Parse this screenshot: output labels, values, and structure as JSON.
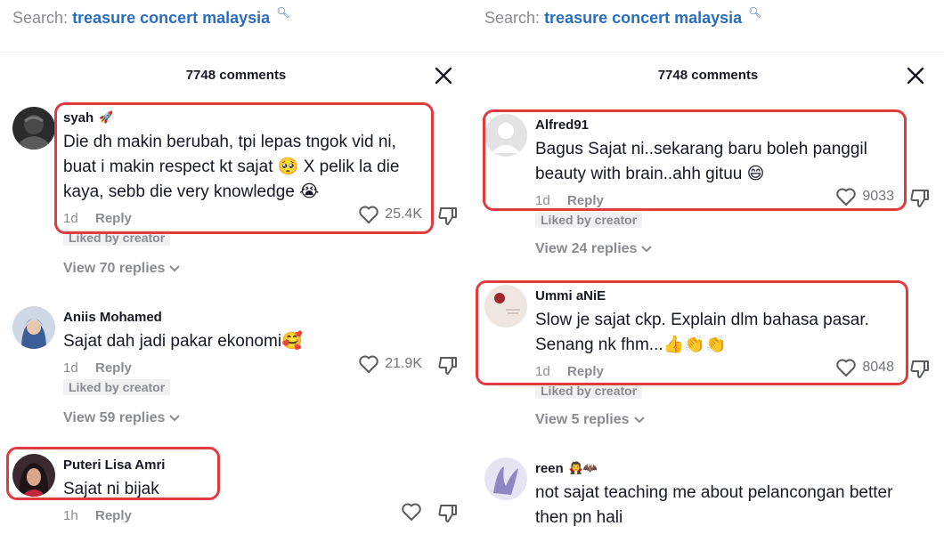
{
  "left": {
    "search_prefix": "Search:",
    "search_query": "treasure concert malaysia",
    "comment_count": "7748 comments",
    "comments": [
      {
        "username": "syah",
        "username_emoji": "🚀",
        "text": "Die dh makin berubah, tpi lepas tngok vid ni, buat i makin respect kt sajat 🥺 X pelik la die kaya, sebb die very knowledge 😭",
        "time": "1d",
        "reply": "Reply",
        "likes": "25.4K",
        "liked_by_creator": "Liked by creator",
        "view_replies": "View 70 replies"
      },
      {
        "username": "Aniis Mohamed",
        "text": "Sajat dah jadi pakar ekonomi🥰",
        "time": "1d",
        "reply": "Reply",
        "likes": "21.9K",
        "liked_by_creator": "Liked by creator",
        "view_replies": "View 59 replies"
      },
      {
        "username": "Puteri Lisa Amri",
        "text": "Sajat ni bijak",
        "time": "1h",
        "reply": "Reply",
        "likes": ""
      }
    ]
  },
  "right": {
    "search_prefix": "Search:",
    "search_query": "treasure concert malaysia",
    "comment_count": "7748 comments",
    "comments": [
      {
        "username": "Alfred91",
        "text": "Bagus Sajat ni..sekarang baru boleh panggil beauty with brain..ahh gituu 😄",
        "time": "1d",
        "reply": "Reply",
        "likes": "9033",
        "liked_by_creator": "Liked by creator",
        "view_replies": "View 24 replies"
      },
      {
        "username": "Ummi aNiE",
        "text": "Slow je sajat ckp. Explain dlm bahasa pasar. Senang nk fhm...👍👏👏",
        "time": "1d",
        "reply": "Reply",
        "likes": "8048",
        "liked_by_creator": "Liked by creator",
        "view_replies": "View 5 replies"
      },
      {
        "username": "reen",
        "username_emoji": "🧛🦇",
        "text": "not sajat teaching me about pelancongan better then pn hali"
      }
    ]
  },
  "colors": {
    "highlight": "#e03b41",
    "link": "#2a6ebc",
    "muted": "#8a8b91"
  }
}
